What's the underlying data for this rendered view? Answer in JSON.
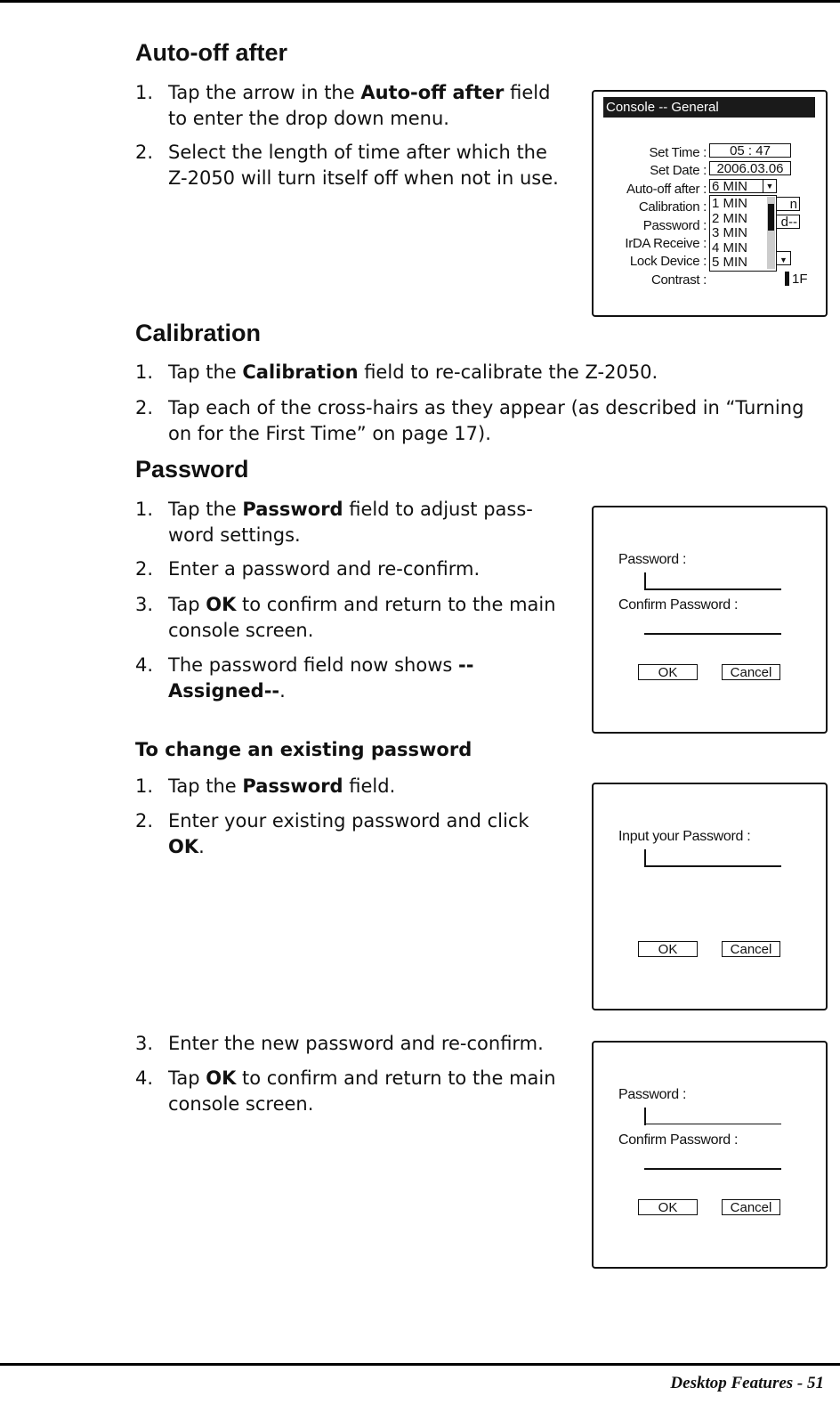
{
  "sections": {
    "autooff": {
      "heading": "Auto-off after",
      "items": [
        {
          "num": "1.",
          "pre": "Tap the arrow in the ",
          "bold": "Auto-off after",
          "post": " field to enter the drop down menu."
        },
        {
          "num": "2.",
          "pre": "Select the length of time after which the Z-2050 will turn itself off when not in use."
        }
      ]
    },
    "calibration": {
      "heading": "Calibration",
      "items": [
        {
          "num": "1.",
          "pre": "Tap the ",
          "bold": "Calibration",
          "post": " field to re-calibrate the Z-2050."
        },
        {
          "num": "2.",
          "pre": "Tap each of the cross-hairs as they appear (as described in “Turning on for the First Time” on page 17)."
        }
      ]
    },
    "password": {
      "heading": "Password",
      "items": [
        {
          "num": "1.",
          "pre": "Tap the ",
          "bold": "Password",
          "post": " field to adjust pass-word settings."
        },
        {
          "num": "2.",
          "pre": "Enter a password and re-confirm."
        },
        {
          "num": "3.",
          "pre": "Tap ",
          "bold": "OK",
          "post": " to confirm and return to the main console screen."
        },
        {
          "num": "4.",
          "pre": "The password field now shows ",
          "bold": "--Assigned--",
          "post": "."
        }
      ]
    },
    "change": {
      "heading": "To change an existing password",
      "items": [
        {
          "num": "1.",
          "pre": "Tap the ",
          "bold": "Password",
          "post": " field."
        },
        {
          "num": "2.",
          "pre": "Enter your existing password and click ",
          "bold": "OK",
          "post": "."
        },
        {
          "num": "3.",
          "pre": "Enter the new password and re-confirm."
        },
        {
          "num": "4.",
          "pre": "Tap ",
          "bold": "OK",
          "post": " to confirm and return to the main console screen."
        }
      ]
    }
  },
  "console": {
    "title": "Console -- General",
    "labels": [
      "Set Time :",
      "Set Date :",
      "Auto-off after :",
      "Calibration :",
      "Password :",
      "IrDA Receive :",
      "Lock Device :",
      "Contrast :"
    ],
    "time": "05 : 47",
    "date": "2006.03.06",
    "autooff_value": "6 MIN",
    "options": [
      "1 MIN",
      "2 MIN",
      "3 MIN",
      "4 MIN",
      "5 MIN"
    ],
    "calibration_partial": "n",
    "password_partial": "d--",
    "contrast_value": "1F"
  },
  "dialog_set": {
    "password_label": "Password :",
    "confirm_label": "Confirm Password :",
    "ok": "OK",
    "cancel": "Cancel"
  },
  "dialog_input": {
    "label": "Input your Password :",
    "ok": "OK",
    "cancel": "Cancel"
  },
  "footer": "Desktop Features - 51"
}
